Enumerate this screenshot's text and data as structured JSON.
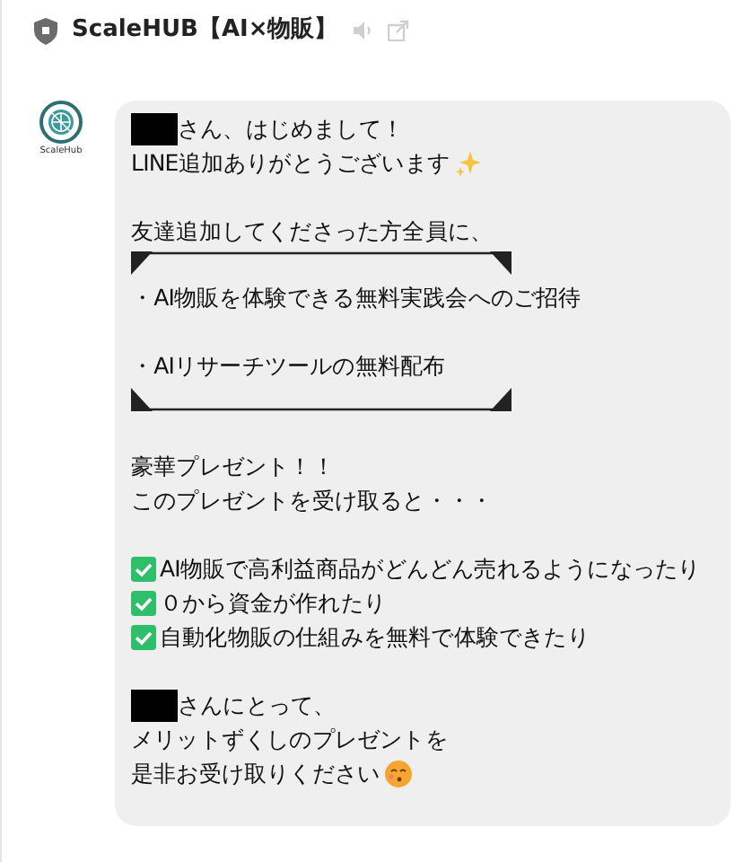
{
  "header": {
    "title": "ScaleHUB【AI×物販】"
  },
  "avatar": {
    "label": "ScaleHub"
  },
  "message": {
    "lines": [
      {
        "kind": "redacted",
        "text": "さん、はじめまして！"
      },
      {
        "kind": "sparkle",
        "text": "LINE追加ありがとうございます"
      },
      {
        "kind": "blank"
      },
      {
        "kind": "text",
        "text": "友達追加してくださった方全員に、"
      },
      {
        "kind": "bracket_top"
      },
      {
        "kind": "text",
        "text": "・AI物販を体験できる無料実践会へのご招待"
      },
      {
        "kind": "blank"
      },
      {
        "kind": "text",
        "text": "・AIリサーチツールの無料配布"
      },
      {
        "kind": "bracket_bottom"
      },
      {
        "kind": "blank"
      },
      {
        "kind": "text",
        "text": "豪華プレゼント！！"
      },
      {
        "kind": "text",
        "text": "このプレゼントを受け取ると・・・"
      },
      {
        "kind": "blank"
      },
      {
        "kind": "check",
        "text": "AI物販で高利益商品がどんどん売れるようになったり"
      },
      {
        "kind": "check",
        "text": "０から資金が作れたり"
      },
      {
        "kind": "check",
        "text": "自動化物販の仕組みを無料で体験できたり"
      },
      {
        "kind": "blank"
      },
      {
        "kind": "redacted",
        "text": "さんにとって、"
      },
      {
        "kind": "text",
        "text": "メリットずくしのプレゼントを"
      },
      {
        "kind": "kiss",
        "text": "是非お受け取りください"
      }
    ]
  }
}
